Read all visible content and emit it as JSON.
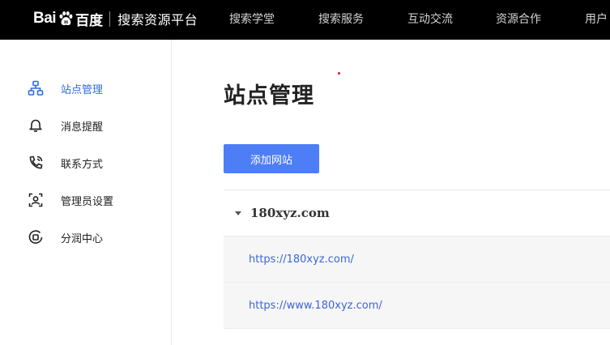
{
  "header": {
    "logo": {
      "bai": "Bai",
      "du": "百度",
      "platform": "搜索资源平台"
    },
    "nav": [
      {
        "label": "搜索学堂"
      },
      {
        "label": "搜索服务"
      },
      {
        "label": "互动交流"
      },
      {
        "label": "资源合作"
      },
      {
        "label": "用户"
      }
    ]
  },
  "sidebar": {
    "items": [
      {
        "label": "站点管理",
        "icon": "sitemap-icon",
        "active": true
      },
      {
        "label": "消息提醒",
        "icon": "bell-icon",
        "active": false
      },
      {
        "label": "联系方式",
        "icon": "phone-icon",
        "active": false
      },
      {
        "label": "管理员设置",
        "icon": "admin-user-icon",
        "active": false
      },
      {
        "label": "分润中心",
        "icon": "revenue-icon",
        "active": false
      }
    ]
  },
  "main": {
    "title": "站点管理",
    "add_button": "添加网站",
    "site": {
      "domain": "180xyz.com",
      "urls": [
        "https://180xyz.com/",
        "https://www.180xyz.com/"
      ]
    }
  },
  "colors": {
    "accent": "#4e7ef5",
    "link": "#3b66d6",
    "active_nav": "#2e6be6",
    "topbar": "#000000"
  }
}
